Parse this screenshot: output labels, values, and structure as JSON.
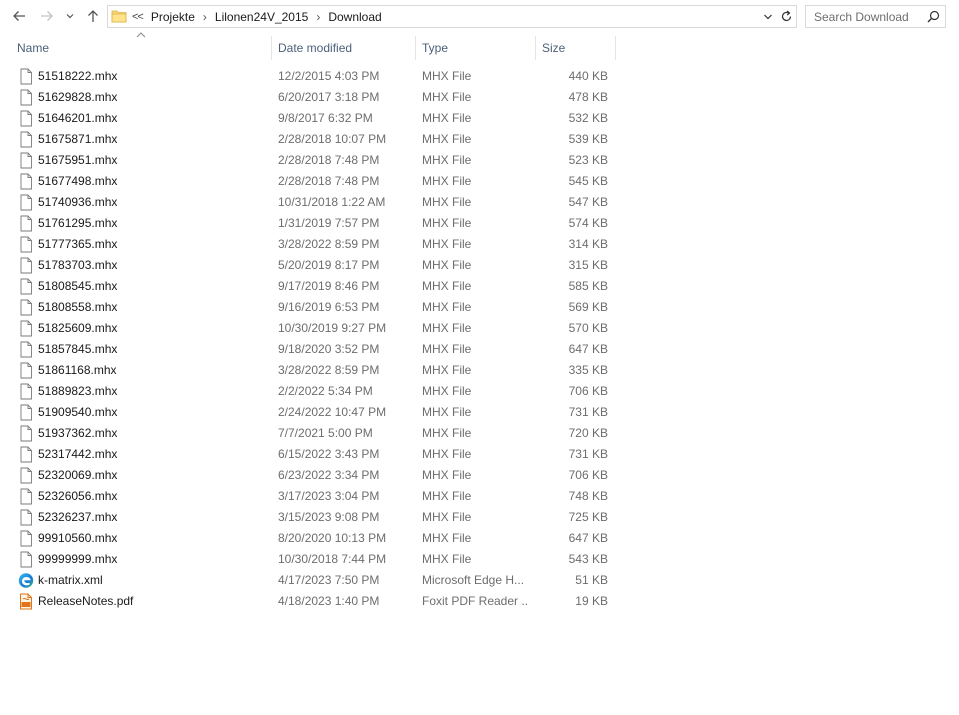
{
  "nav": {
    "back_icon": "arrow-left-icon",
    "forward_icon": "arrow-right-icon",
    "recent_icon": "chevron-down-icon",
    "up_icon": "arrow-up-icon"
  },
  "address": {
    "overflow": "<<",
    "crumbs": [
      "Projekte",
      "Lilonen24V_2015",
      "Download"
    ]
  },
  "search": {
    "placeholder": "Search Download"
  },
  "columns": {
    "name": "Name",
    "date": "Date modified",
    "type": "Type",
    "size": "Size",
    "sorted_by": "name"
  },
  "files": [
    {
      "name": "51518222.mhx",
      "date": "12/2/2015 4:03 PM",
      "type": "MHX File",
      "size": "440 KB",
      "icon": "file-icon"
    },
    {
      "name": "51629828.mhx",
      "date": "6/20/2017 3:18 PM",
      "type": "MHX File",
      "size": "478 KB",
      "icon": "file-icon"
    },
    {
      "name": "51646201.mhx",
      "date": "9/8/2017 6:32 PM",
      "type": "MHX File",
      "size": "532 KB",
      "icon": "file-icon"
    },
    {
      "name": "51675871.mhx",
      "date": "2/28/2018 10:07 PM",
      "type": "MHX File",
      "size": "539 KB",
      "icon": "file-icon"
    },
    {
      "name": "51675951.mhx",
      "date": "2/28/2018 7:48 PM",
      "type": "MHX File",
      "size": "523 KB",
      "icon": "file-icon"
    },
    {
      "name": "51677498.mhx",
      "date": "2/28/2018 7:48 PM",
      "type": "MHX File",
      "size": "545 KB",
      "icon": "file-icon"
    },
    {
      "name": "51740936.mhx",
      "date": "10/31/2018 1:22 AM",
      "type": "MHX File",
      "size": "547 KB",
      "icon": "file-icon"
    },
    {
      "name": "51761295.mhx",
      "date": "1/31/2019 7:57 PM",
      "type": "MHX File",
      "size": "574 KB",
      "icon": "file-icon"
    },
    {
      "name": "51777365.mhx",
      "date": "3/28/2022 8:59 PM",
      "type": "MHX File",
      "size": "314 KB",
      "icon": "file-icon"
    },
    {
      "name": "51783703.mhx",
      "date": "5/20/2019 8:17 PM",
      "type": "MHX File",
      "size": "315 KB",
      "icon": "file-icon"
    },
    {
      "name": "51808545.mhx",
      "date": "9/17/2019 8:46 PM",
      "type": "MHX File",
      "size": "585 KB",
      "icon": "file-icon"
    },
    {
      "name": "51808558.mhx",
      "date": "9/16/2019 6:53 PM",
      "type": "MHX File",
      "size": "569 KB",
      "icon": "file-icon"
    },
    {
      "name": "51825609.mhx",
      "date": "10/30/2019 9:27 PM",
      "type": "MHX File",
      "size": "570 KB",
      "icon": "file-icon"
    },
    {
      "name": "51857845.mhx",
      "date": "9/18/2020 3:52 PM",
      "type": "MHX File",
      "size": "647 KB",
      "icon": "file-icon"
    },
    {
      "name": "51861168.mhx",
      "date": "3/28/2022 8:59 PM",
      "type": "MHX File",
      "size": "335 KB",
      "icon": "file-icon"
    },
    {
      "name": "51889823.mhx",
      "date": "2/2/2022 5:34 PM",
      "type": "MHX File",
      "size": "706 KB",
      "icon": "file-icon"
    },
    {
      "name": "51909540.mhx",
      "date": "2/24/2022 10:47 PM",
      "type": "MHX File",
      "size": "731 KB",
      "icon": "file-icon"
    },
    {
      "name": "51937362.mhx",
      "date": "7/7/2021 5:00 PM",
      "type": "MHX File",
      "size": "720 KB",
      "icon": "file-icon"
    },
    {
      "name": "52317442.mhx",
      "date": "6/15/2022 3:43 PM",
      "type": "MHX File",
      "size": "731 KB",
      "icon": "file-icon"
    },
    {
      "name": "52320069.mhx",
      "date": "6/23/2022 3:34 PM",
      "type": "MHX File",
      "size": "706 KB",
      "icon": "file-icon"
    },
    {
      "name": "52326056.mhx",
      "date": "3/17/2023 3:04 PM",
      "type": "MHX File",
      "size": "748 KB",
      "icon": "file-icon"
    },
    {
      "name": "52326237.mhx",
      "date": "3/15/2023 9:08 PM",
      "type": "MHX File",
      "size": "725 KB",
      "icon": "file-icon"
    },
    {
      "name": "99910560.mhx",
      "date": "8/20/2020 10:13 PM",
      "type": "MHX File",
      "size": "647 KB",
      "icon": "file-icon"
    },
    {
      "name": "99999999.mhx",
      "date": "10/30/2018 7:44 PM",
      "type": "MHX File",
      "size": "543 KB",
      "icon": "file-icon"
    },
    {
      "name": "k-matrix.xml",
      "date": "4/17/2023 7:50 PM",
      "type": "Microsoft Edge H...",
      "size": "51 KB",
      "icon": "edge-icon"
    },
    {
      "name": "ReleaseNotes.pdf",
      "date": "4/18/2023 1:40 PM",
      "type": "Foxit PDF Reader ...",
      "size": "19 KB",
      "icon": "pdf-icon"
    }
  ]
}
